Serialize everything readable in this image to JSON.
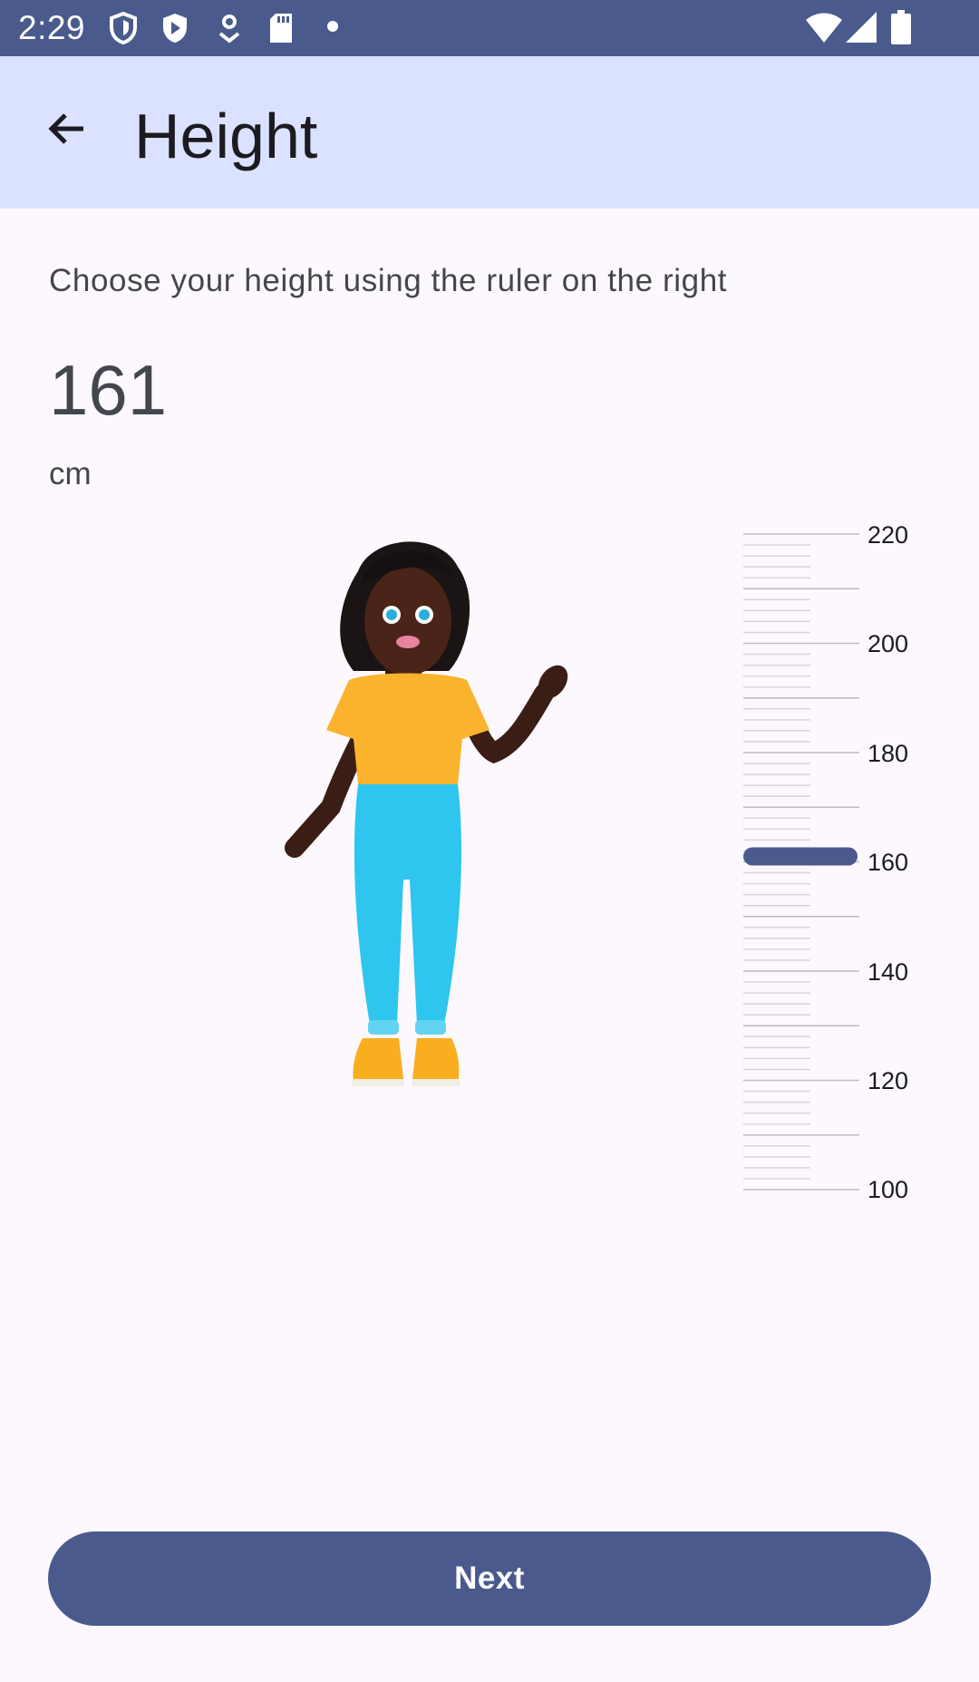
{
  "status_bar": {
    "time": "2:29",
    "left_icons": [
      "shield-icon",
      "play-shield-icon",
      "location-pin-icon",
      "sd-card-icon",
      "dot-icon"
    ],
    "right_icons": [
      "wifi-icon",
      "signal-icon",
      "battery-icon"
    ]
  },
  "app_bar": {
    "title": "Height",
    "back_icon": "arrow-back-icon"
  },
  "content": {
    "instruction": "Choose your height using the ruler on the right",
    "value": "161",
    "unit": "cm"
  },
  "ruler": {
    "labels": [
      "220",
      "200",
      "180",
      "160",
      "140",
      "120",
      "100"
    ],
    "min": 100,
    "max": 220,
    "selected": 161
  },
  "colors": {
    "primary": "#4a5a8d",
    "app_bar_bg": "#dbe2ff",
    "background": "#fcf8fd"
  },
  "footer": {
    "next_label": "Next"
  }
}
